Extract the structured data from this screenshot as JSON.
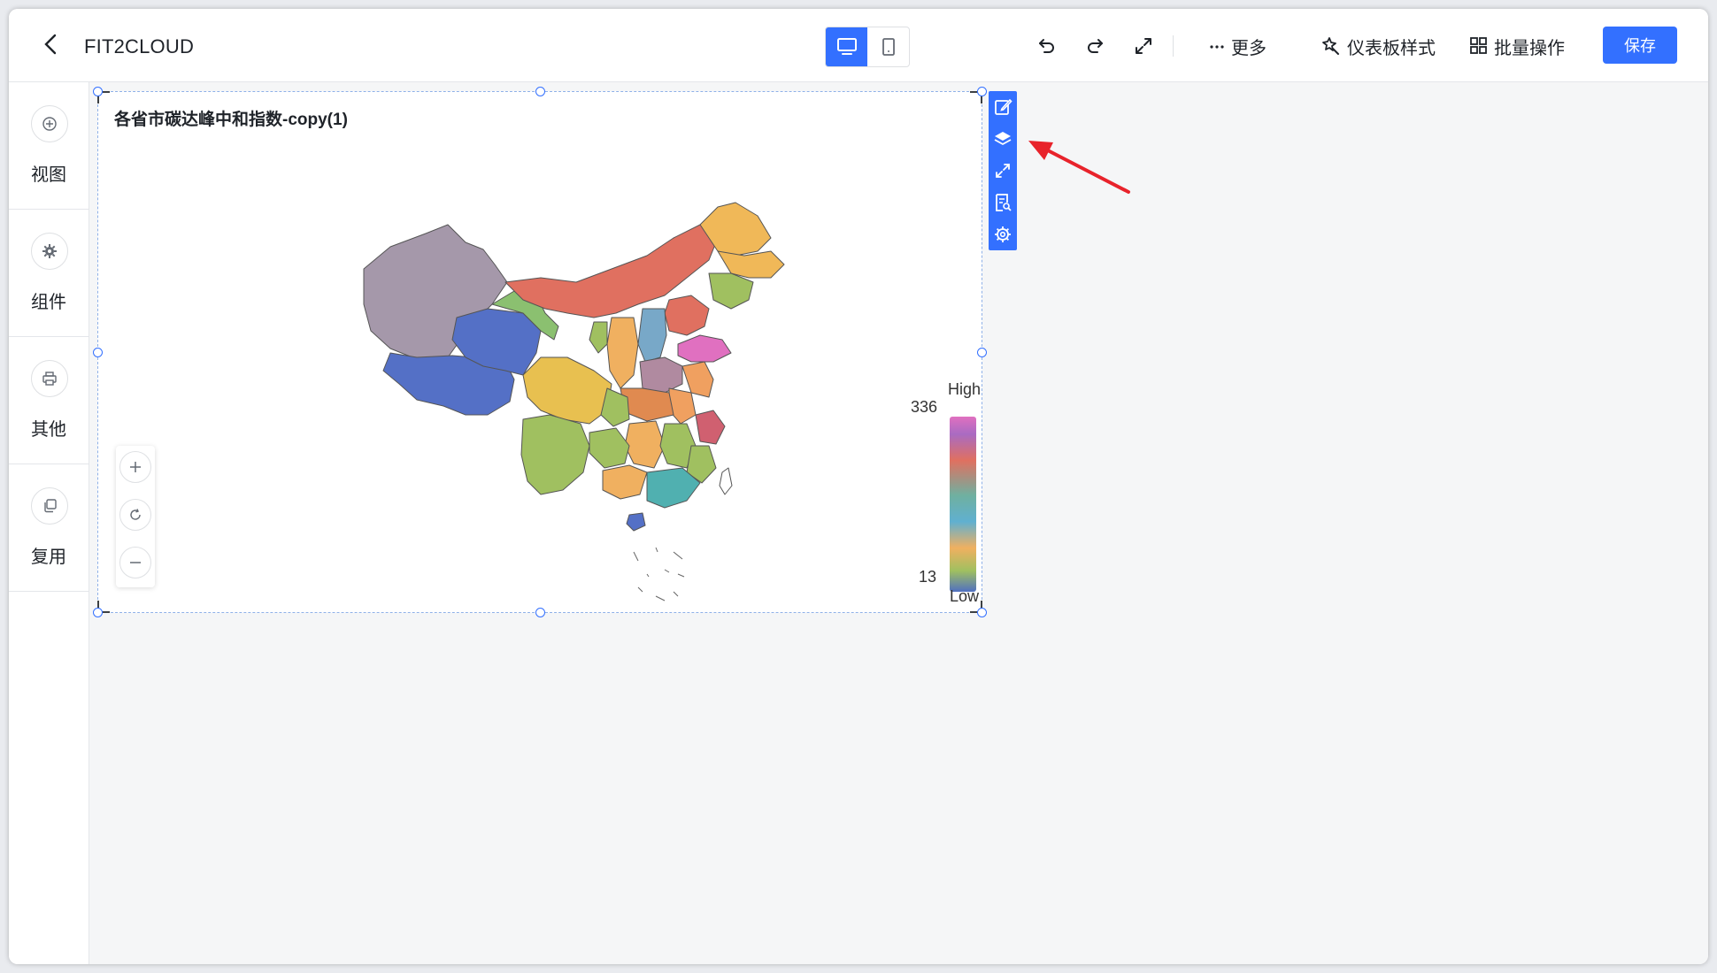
{
  "header": {
    "title": "FIT2CLOUD",
    "more_label": "更多",
    "dashboard_style_label": "仪表板样式",
    "batch_label": "批量操作",
    "save_label": "保存"
  },
  "sidebar": {
    "items": [
      {
        "label": "视图",
        "icon": "plus-circle-icon"
      },
      {
        "label": "组件",
        "icon": "gear-icon"
      },
      {
        "label": "其他",
        "icon": "printer-icon"
      },
      {
        "label": "复用",
        "icon": "copy-icon"
      }
    ]
  },
  "widget": {
    "title": "各省市碳达峰中和指数-copy(1)",
    "legend": {
      "high_label": "High",
      "low_label": "Low",
      "max_value": "336",
      "min_value": "13"
    }
  },
  "colors": {
    "accent": "#3370ff",
    "annotation_arrow": "#e8232b"
  }
}
